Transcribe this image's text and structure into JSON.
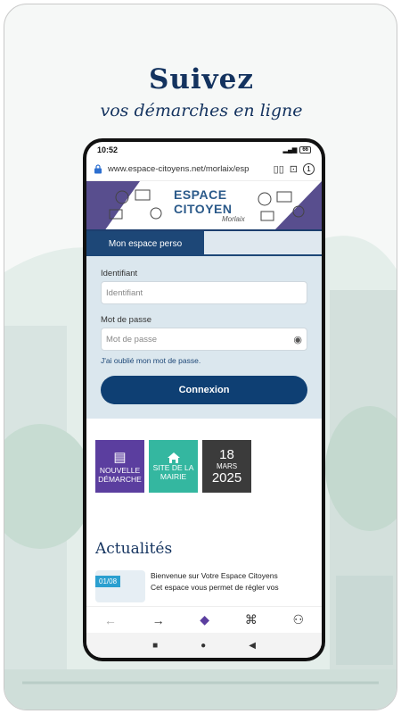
{
  "headline": {
    "title": "Suivez",
    "subtitle": "vos démarches en ligne"
  },
  "phone": {
    "status": {
      "time": "10:52",
      "battery": "66"
    },
    "browser": {
      "url": "www.espace-citoyens.net/morlaix/esp",
      "tab_count": "1"
    },
    "banner": {
      "line1": "ESPACE",
      "line2": "CITOYEN",
      "line3": "Morlaix"
    },
    "tabs": {
      "active": "Mon espace perso"
    },
    "login": {
      "identifiant_label": "Identifiant",
      "identifiant_placeholder": "Identifiant",
      "password_label": "Mot de passe",
      "password_placeholder": "Mot de passe",
      "forgot": "J'ai oublié mon mot de passe.",
      "submit": "Connexion"
    },
    "tiles": {
      "new": "Nouvelle démarche",
      "site": "Site de la mairie",
      "date_day": "18",
      "date_month": "MARS",
      "date_year": "2025"
    },
    "news": {
      "title": "Actualités",
      "date": "01/08",
      "headline": "Bienvenue sur Votre Espace Citoyens",
      "snippet": "Cet espace vous permet de régler vos"
    }
  },
  "colors": {
    "navy": "#14335f",
    "button": "#0e3f73",
    "purple": "#5b3e9f",
    "teal": "#34b7a0",
    "dark": "#3b3b3b"
  }
}
